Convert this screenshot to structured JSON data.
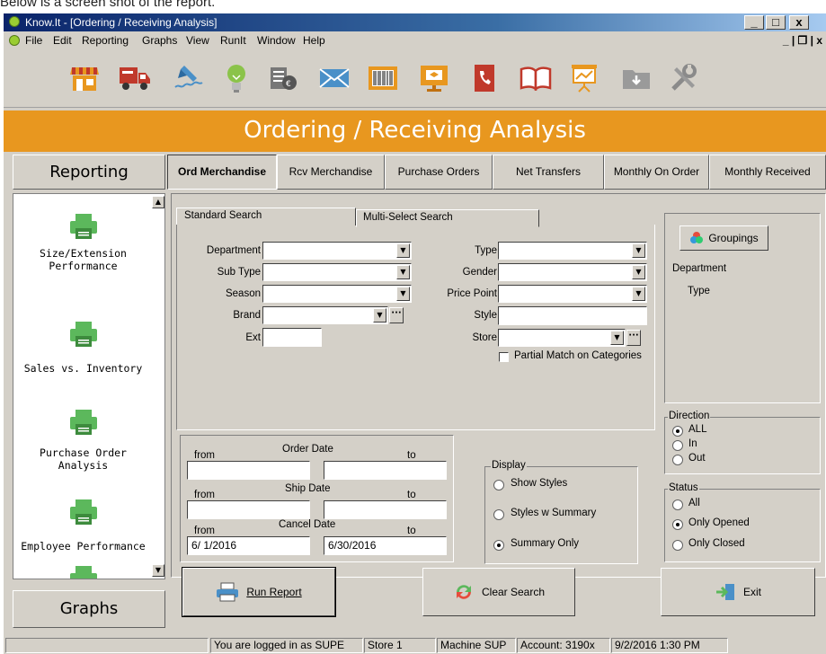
{
  "doc_text": "Below is a screen shot of the report.",
  "window": {
    "title": "Know.It - [Ordering / Receiving Analysis]",
    "min": "_",
    "max": "□",
    "close": "x",
    "mdi_controls": "_ | ❐ | x"
  },
  "menu": [
    "File",
    "Edit",
    "Reporting",
    "Graphs",
    "View",
    "RunIt",
    "Window",
    "Help"
  ],
  "toolbar_icons": [
    "store-icon",
    "delivery-truck-icon",
    "pen-signature-icon",
    "lightbulb-icon",
    "ledger-icon",
    "envelope-icon",
    "barcode-icon",
    "presentation-screen-icon",
    "phone-book-icon",
    "open-book-icon",
    "projector-chart-icon",
    "download-folder-icon",
    "tools-icon"
  ],
  "banner_title": "Ordering / Receiving Analysis",
  "sidebar": {
    "header": "Reporting",
    "footer": "Graphs",
    "items": [
      {
        "label": "Size/Extension Performance"
      },
      {
        "label": "Sales vs. Inventory"
      },
      {
        "label": "Purchase Order Analysis"
      },
      {
        "label": "Employee Performance"
      }
    ]
  },
  "tabs": [
    "Ord Merchandise",
    "Rcv Merchandise",
    "Purchase Orders",
    "Net Transfers",
    "Monthly On Order",
    "Monthly Received"
  ],
  "search_tabs": {
    "standard": "Standard Search",
    "multi": "Multi-Select Search"
  },
  "left_fields": {
    "department": "Department",
    "sub_type": "Sub Type",
    "season": "Season",
    "brand": "Brand",
    "ext": "Ext"
  },
  "right_fields": {
    "type": "Type",
    "gender": "Gender",
    "price_point": "Price Point",
    "style": "Style",
    "store": "Store"
  },
  "partial_match": "Partial Match on Categories",
  "groupings": {
    "button": "Groupings",
    "items": [
      "Department",
      "Type"
    ]
  },
  "dates": {
    "from": "from",
    "to": "to",
    "order_date": "Order Date",
    "ship_date": "Ship Date",
    "cancel_date": "Cancel Date",
    "cancel_from": "6/ 1/2016",
    "cancel_to": "6/30/2016"
  },
  "display": {
    "title": "Display",
    "options": [
      "Show Styles",
      "Styles w Summary",
      "Summary Only"
    ],
    "selected": "Summary Only"
  },
  "direction": {
    "title": "Direction",
    "options": [
      "ALL",
      "In",
      "Out"
    ],
    "selected": "ALL"
  },
  "status_group": {
    "title": "Status",
    "options": [
      "All",
      "Only Opened",
      "Only Closed"
    ],
    "selected": "Only Opened"
  },
  "buttons": {
    "run_report": "Run Report",
    "clear_search": "Clear Search",
    "exit": "Exit"
  },
  "statusbar": [
    "",
    "You are logged in as SUPE",
    "Store 1",
    "Machine SUP",
    "Account: 3190x",
    "9/2/2016 1:30 PM"
  ],
  "colors": {
    "banner": "#e8971f",
    "title_bar": "#0a246a",
    "face": "#d4d0c8"
  }
}
